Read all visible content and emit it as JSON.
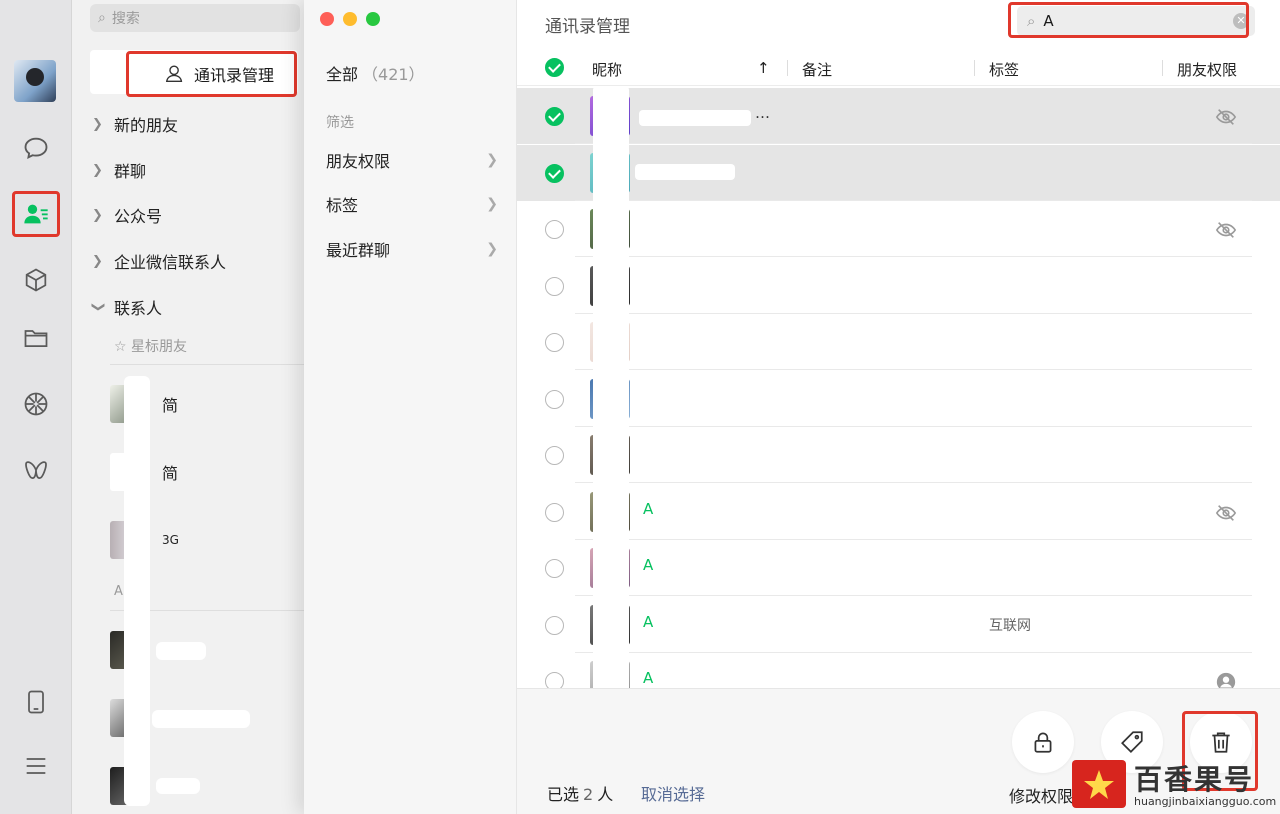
{
  "contacts_panel": {
    "search_placeholder": "搜索",
    "manager_button": "通讯录管理",
    "groups": [
      "新的朋友",
      "群聊",
      "公众号",
      "企业微信联系人",
      "联系人"
    ],
    "starred_label": "☆ 星标朋友",
    "starred_contacts": [
      "简",
      "简",
      "3G"
    ],
    "section_letter": "A"
  },
  "manager": {
    "filter_all_label": "全部",
    "filter_all_count": "（421）",
    "filter_section": "筛选",
    "filters": [
      "朋友权限",
      "标签",
      "最近群聊"
    ],
    "title": "通讯录管理",
    "search_value": "A",
    "columns": {
      "nickname": "昵称",
      "sort_icon": "arrow-up-icon",
      "remark": "备注",
      "tag": "标签",
      "permission": "朋友权限"
    },
    "rows": [
      {
        "selected": true,
        "name_hl": "",
        "name": "…",
        "tag": "",
        "perm": "eye-slash-icon"
      },
      {
        "selected": true,
        "name_hl": "",
        "name": "",
        "tag": "",
        "perm": ""
      },
      {
        "selected": false,
        "name_hl": "",
        "name": "",
        "tag": "",
        "perm": "eye-slash-icon"
      },
      {
        "selected": false,
        "name_hl": "",
        "name": "",
        "tag": "",
        "perm": ""
      },
      {
        "selected": false,
        "name_hl": "",
        "name": "",
        "tag": "",
        "perm": ""
      },
      {
        "selected": false,
        "name_hl": "",
        "name": "",
        "tag": "",
        "perm": ""
      },
      {
        "selected": false,
        "name_hl": "",
        "name": "",
        "tag": "",
        "perm": ""
      },
      {
        "selected": false,
        "name_hl": "A",
        "name": "",
        "tag": "",
        "perm": "eye-slash-icon"
      },
      {
        "selected": false,
        "name_hl": "A",
        "name": "",
        "tag": "",
        "perm": ""
      },
      {
        "selected": false,
        "name_hl": "A",
        "name": "",
        "tag": "互联网",
        "perm": ""
      },
      {
        "selected": false,
        "name_hl": "A",
        "name": "",
        "tag": "",
        "perm": "person-circle-icon"
      }
    ],
    "footer": {
      "selected_prefix": "已选",
      "selected_count": "2",
      "selected_suffix": "人",
      "cancel_select": "取消选择",
      "permission_label": "修改权限"
    }
  },
  "watermark": {
    "text": "百香果号",
    "url": "huangjinbaixiangguo.com"
  },
  "colors": {
    "accent_green": "#07c160",
    "highlight_red": "#e0382c",
    "link_blue": "#576b95"
  }
}
